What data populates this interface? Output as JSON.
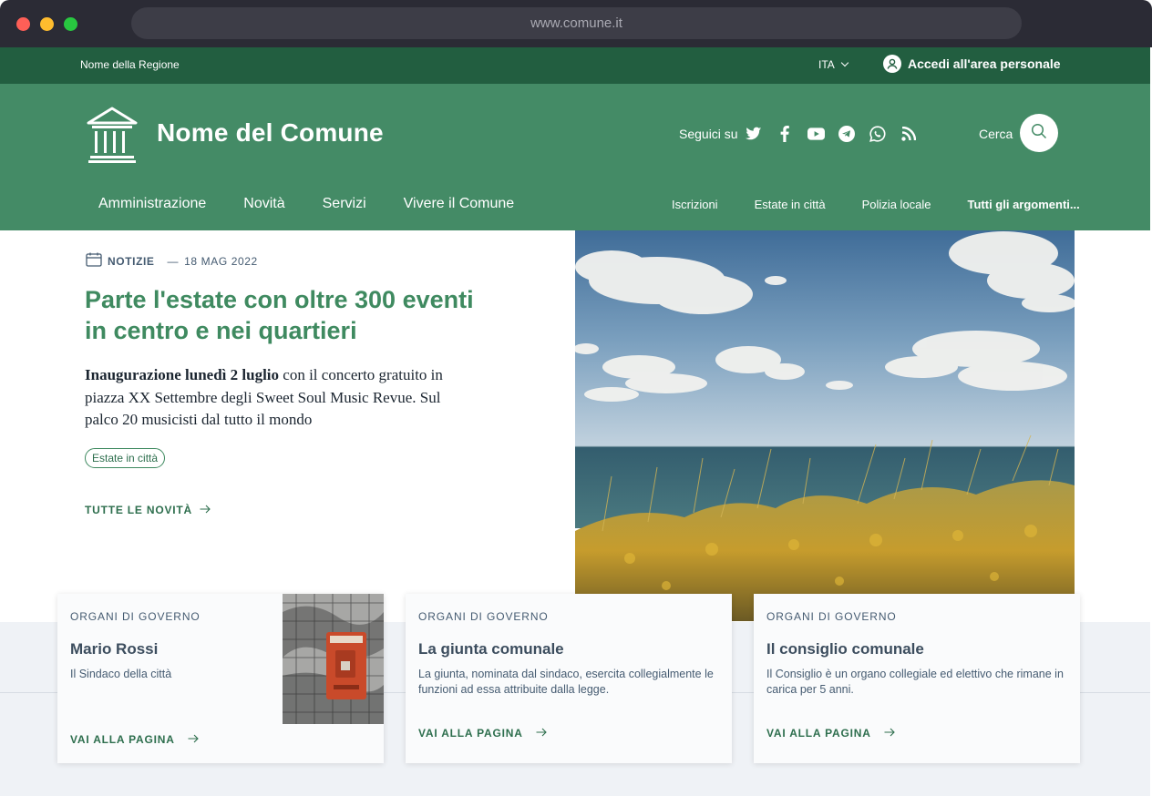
{
  "browser": {
    "url": "www.comune.it"
  },
  "slim_header": {
    "region": "Nome della Regione",
    "language": "ITA",
    "login_label": "Accedi all'area personale"
  },
  "header": {
    "site_name": "Nome del Comune",
    "follow_label": "Seguici su",
    "social_icons": [
      "twitter-icon",
      "facebook-icon",
      "youtube-icon",
      "telegram-icon",
      "whatsapp-icon",
      "rss-icon"
    ],
    "search_label": "Cerca"
  },
  "main_nav": [
    "Amministrazione",
    "Novità",
    "Servizi",
    "Vivere il Comune"
  ],
  "secondary_nav": [
    "Iscrizioni",
    "Estate in città",
    "Polizia locale",
    "Tutti gli argomenti..."
  ],
  "hero": {
    "category": "NOTIZIE",
    "date": "18 MAG 2022",
    "title": "Parte l'estate con oltre 300 eventi in centro e nei quartieri",
    "text_bold": "Inaugurazione lunedì 2 luglio",
    "text_rest": " con il concerto gratuito in piazza XX Settembre degli Sweet Soul Music Revue. Sul palco 20 musicisti dal tutto il mondo",
    "tag": "Estate in città",
    "all_news": "TUTTE LE NOVITÀ"
  },
  "cards": [
    {
      "kicker": "ORGANI DI GOVERNO",
      "title": "Mario Rossi",
      "description": "Il Sindaco della città",
      "cta": "VAI ALLA PAGINA"
    },
    {
      "kicker": "ORGANI DI GOVERNO",
      "title": "La giunta comunale",
      "description": "La giunta, nominata dal sindaco, esercita collegialmente le funzioni ad essa attribuite dalla legge.",
      "cta": "VAI ALLA PAGINA"
    },
    {
      "kicker": "ORGANI DI GOVERNO",
      "title": "Il consiglio comunale",
      "description": "Il Consiglio è un organo collegiale ed elettivo che rimane in carica per 5 anni.",
      "cta": "VAI ALLA PAGINA"
    }
  ],
  "colors": {
    "primary": "#448b66",
    "slim": "#225e40",
    "title_green": "#3f8a60",
    "link_green": "#2d6e4d"
  }
}
